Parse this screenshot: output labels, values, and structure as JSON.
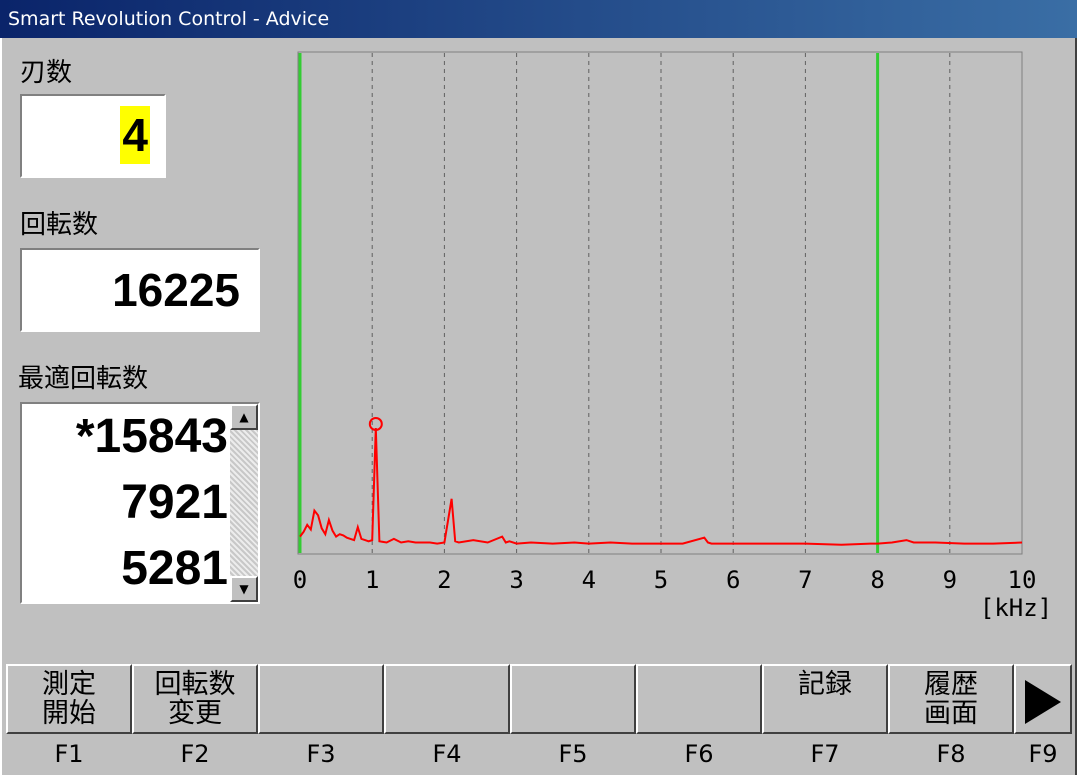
{
  "window": {
    "title": "Smart Revolution Control - Advice"
  },
  "left": {
    "blades_label": "刃数",
    "blades_value": "4",
    "rpm_label": "回転数",
    "rpm_value": "16225",
    "optimal_label": "最適回転数",
    "optimal_list": [
      "*15843",
      "7921",
      "5281"
    ]
  },
  "chart_data": {
    "type": "line",
    "xlabel": "[kHz]",
    "xlim": [
      0,
      10
    ],
    "x_ticks": [
      "0",
      "1",
      "2",
      "3",
      "4",
      "5",
      "6",
      "7",
      "8",
      "9",
      "10"
    ],
    "grid": "vertical dashed",
    "markers": [
      {
        "type": "green-line",
        "x": 0
      },
      {
        "type": "green-line",
        "x": 8
      },
      {
        "type": "circle-marker",
        "x": 1.05
      }
    ],
    "series": [
      {
        "color": "#ff0000",
        "x": [
          0.0,
          0.05,
          0.1,
          0.15,
          0.2,
          0.25,
          0.3,
          0.35,
          0.4,
          0.45,
          0.5,
          0.55,
          0.6,
          0.65,
          0.7,
          0.75,
          0.8,
          0.85,
          0.9,
          0.95,
          1.0,
          1.05,
          1.1,
          1.2,
          1.3,
          1.4,
          1.5,
          1.6,
          1.8,
          1.9,
          2.0,
          2.1,
          2.15,
          2.2,
          2.4,
          2.6,
          2.8,
          2.85,
          2.9,
          3.0,
          3.2,
          3.5,
          3.8,
          4.0,
          4.3,
          4.6,
          5.0,
          5.3,
          5.6,
          5.65,
          5.7,
          6.0,
          6.5,
          7.0,
          7.5,
          7.9,
          8.0,
          8.2,
          8.4,
          8.45,
          8.5,
          8.8,
          9.2,
          9.6,
          10.0
        ],
        "y": [
          8,
          12,
          18,
          14,
          30,
          26,
          15,
          10,
          22,
          13,
          8,
          10,
          9,
          7,
          6,
          5,
          16,
          6,
          5,
          4,
          5,
          100,
          4,
          3,
          6,
          3,
          4,
          3,
          3,
          2,
          3,
          40,
          4,
          3,
          5,
          3,
          8,
          3,
          4,
          2,
          3,
          2,
          3,
          2,
          3,
          2,
          2,
          2,
          7,
          3,
          2,
          2,
          2,
          2,
          1,
          2,
          2,
          3,
          5,
          4,
          3,
          3,
          2,
          2,
          3
        ]
      }
    ]
  },
  "function_keys": [
    {
      "key": "F1",
      "label": "測定\n開始"
    },
    {
      "key": "F2",
      "label": "回転数\n変更"
    },
    {
      "key": "F3",
      "label": ""
    },
    {
      "key": "F4",
      "label": ""
    },
    {
      "key": "F5",
      "label": ""
    },
    {
      "key": "F6",
      "label": ""
    },
    {
      "key": "F7",
      "label": "記録"
    },
    {
      "key": "F8",
      "label": "履歴\n画面"
    },
    {
      "key": "F9",
      "label": ""
    }
  ]
}
